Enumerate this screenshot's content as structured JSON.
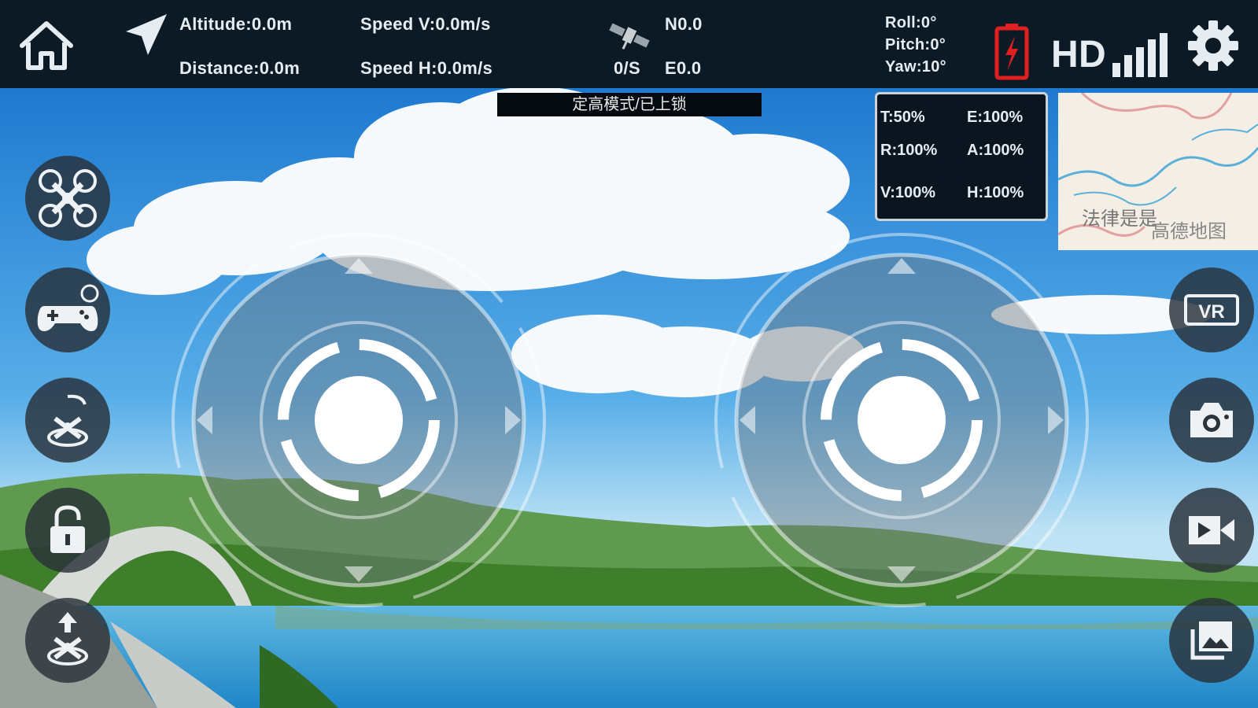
{
  "telemetry": {
    "altitude": "Altitude:0.0m",
    "distance": "Distance:0.0m",
    "speed_v": "Speed V:0.0m/s",
    "speed_h": "Speed H:0.0m/s",
    "satellites": "0/S",
    "north": "N0.0",
    "east": "E0.0",
    "roll": "Roll:0°",
    "pitch": "Pitch:0°",
    "yaw": "Yaw:10°",
    "hd_label": "HD"
  },
  "mode_banner": "定高模式/已上锁",
  "rates": {
    "t": "T:50%",
    "e": "E:100%",
    "r": "R:100%",
    "a": "A:100%",
    "v": "V:100%",
    "h": "H:100%"
  },
  "map": {
    "place_label": "法律是是",
    "provider_label": "高德地图"
  },
  "icons": {
    "home": "home-icon",
    "location": "location-arrow-icon",
    "satellite": "satellite-icon",
    "battery": "battery-icon",
    "signal": "signal-bars-icon",
    "settings": "gear-icon",
    "drone": "drone-icon",
    "gamepad": "gamepad-icon",
    "headless": "headless-mode-icon",
    "lock": "lock-icon",
    "takeoff": "takeoff-icon",
    "vr": "vr-icon",
    "camera": "camera-icon",
    "video": "video-icon",
    "gallery": "gallery-icon"
  },
  "colors": {
    "topbar": "#0c1a26",
    "battery_alert": "#e02020",
    "button_bg": "#2b333b"
  }
}
